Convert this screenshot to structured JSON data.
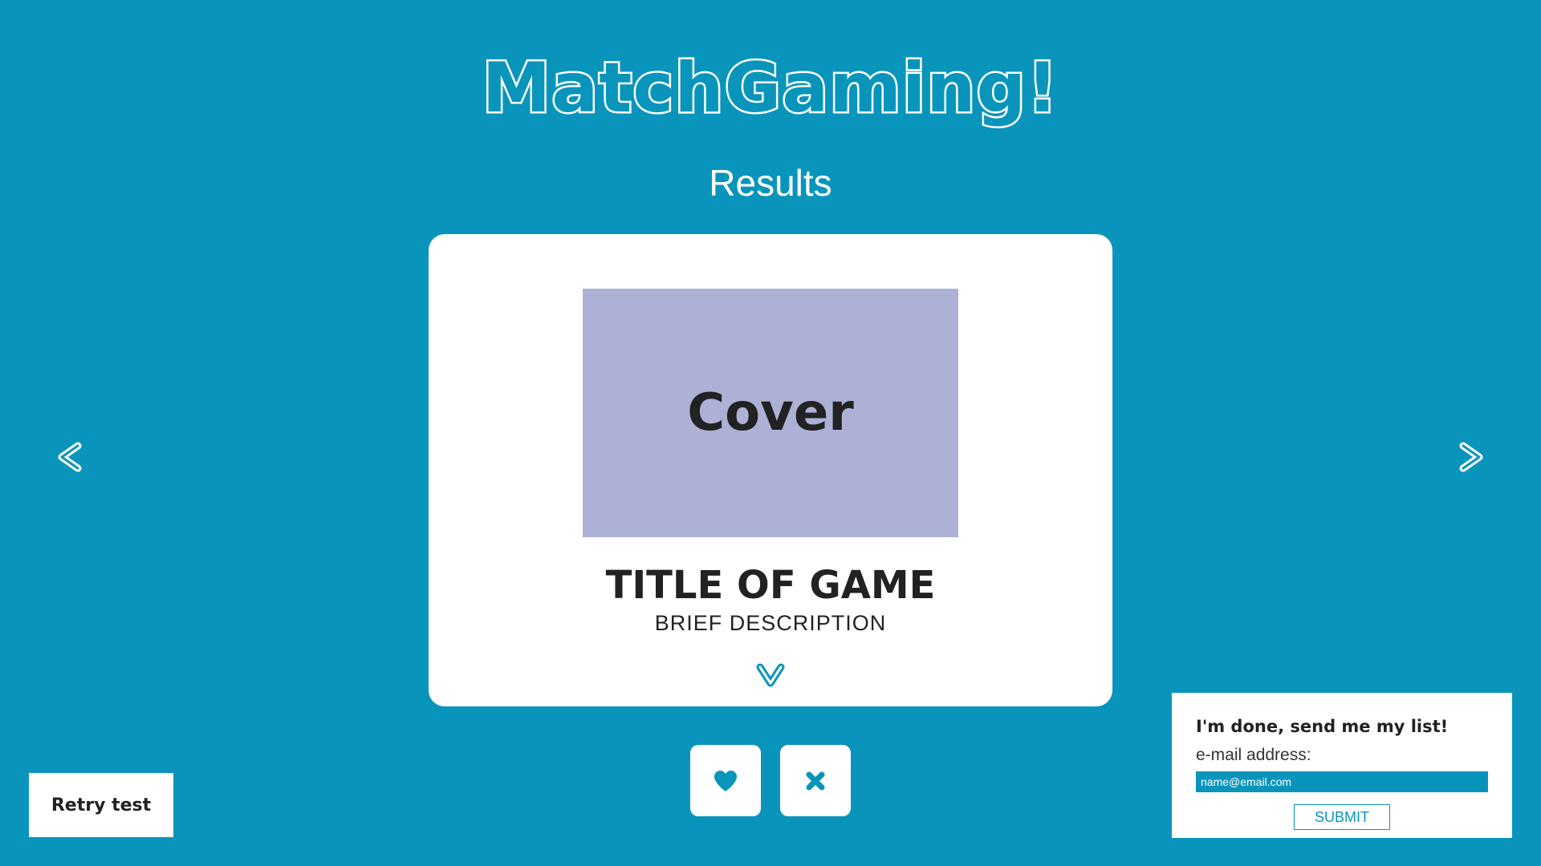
{
  "app": {
    "title": "MatchGaming!",
    "subtitle": "Results"
  },
  "card": {
    "cover_label": "Cover",
    "game_title": "TITLE OF GAME",
    "game_description": "BRIEF DESCRIPTION",
    "expand_icon": "chevron-down-icon"
  },
  "navigation": {
    "prev_icon": "chevron-left-icon",
    "next_icon": "chevron-right-icon"
  },
  "actions": {
    "like_icon": "heart-icon",
    "dislike_icon": "close-icon"
  },
  "retry": {
    "label": "Retry test"
  },
  "send_list": {
    "heading": "I'm done, send me my list!",
    "email_label": "e-mail address:",
    "email_placeholder": "name@email.com",
    "email_value": "",
    "submit_label": "SUBMIT"
  },
  "colors": {
    "background": "#0995bb",
    "cover": "#adb1d5",
    "card": "#ffffff",
    "text_dark": "#222222",
    "accent": "#0995bb"
  }
}
